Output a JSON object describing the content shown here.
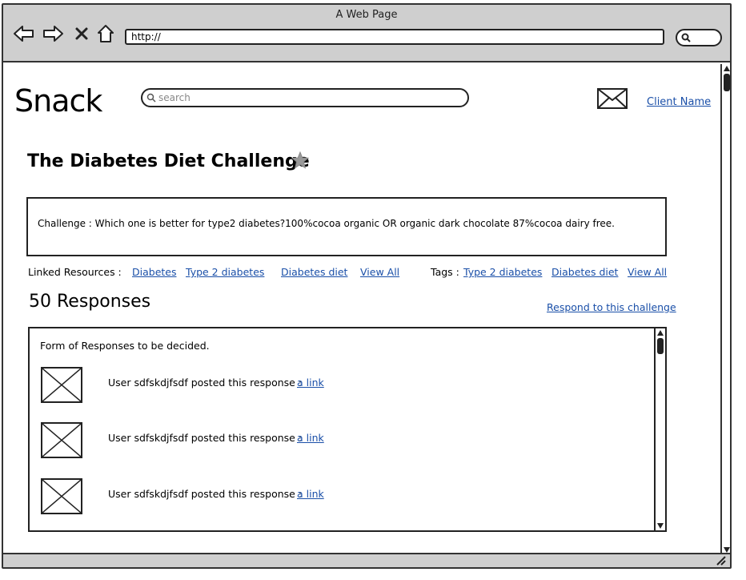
{
  "window": {
    "title": "A Web Page"
  },
  "browser": {
    "url": "http://",
    "nav_icons": [
      "back-arrow-icon",
      "forward-arrow-icon",
      "stop-icon",
      "home-icon"
    ]
  },
  "header": {
    "logo": "Snack",
    "search_placeholder": "search",
    "client_name": "Client Name"
  },
  "challenge": {
    "title": "The Diabetes Diet Challenge",
    "text": "Challenge : Which one is better for type2 diabetes?100%cocoa organic OR organic dark chocolate 87%cocoa dairy free."
  },
  "linked_resources": {
    "label": "Linked Resources :",
    "links": [
      "Diabetes",
      "Type 2 diabetes",
      "Diabetes diet"
    ],
    "view_all": "View All"
  },
  "tags": {
    "label": "Tags :",
    "links": [
      "Type 2 diabetes",
      "Diabetes diet"
    ],
    "view_all": "View All"
  },
  "responses": {
    "count_label": "50 Responses",
    "respond_link": "Respond to this challenge",
    "intro": "Form of Responses to be decided.",
    "items": [
      {
        "text": "User sdfskdjfsdf posted this response :",
        "link": "a link"
      },
      {
        "text": "User sdfskdjfsdf posted this response :",
        "link": "a link"
      },
      {
        "text": "User sdfskdjfsdf posted this response :",
        "link": "a link"
      }
    ]
  },
  "colors": {
    "link": "#1a4fa8",
    "chrome": "#cfcfcf",
    "border": "#222222"
  }
}
